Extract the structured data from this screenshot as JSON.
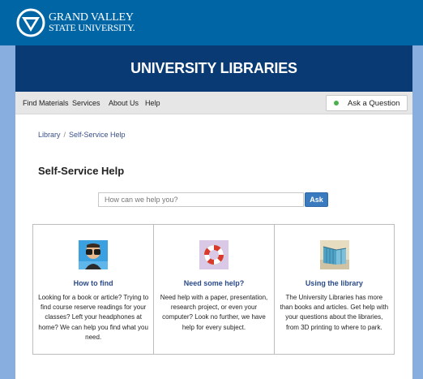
{
  "brand": {
    "logo_line1": "GRAND VALLEY",
    "logo_line2": "STATE UNIVERSITY."
  },
  "banner": {
    "title": "UNIVERSITY LIBRARIES"
  },
  "nav": {
    "items": [
      "Find Materials",
      "Services",
      "About Us",
      "Help"
    ],
    "ask_label": "Ask a Question",
    "ask_status_color": "#4caf50"
  },
  "breadcrumb": {
    "home": "Library",
    "separator": "/",
    "current": "Self-Service Help"
  },
  "page": {
    "title": "Self-Service Help"
  },
  "search": {
    "placeholder": "How can we help you?",
    "button_label": "Ask"
  },
  "panels": [
    {
      "icon": "binoculars-icon",
      "title": "How to find",
      "description": "Looking for a book or article? Trying to find course reserve readings for your classes? Left your headphones at home? We can help you find what you need."
    },
    {
      "icon": "life-preserver-icon",
      "title": "Need some help?",
      "description": "Need help with a paper, presentation, research project, or even your computer? Look no further, we have help for every subject."
    },
    {
      "icon": "library-building-icon",
      "title": "Using the library",
      "description": "The University Libraries has more than books and articles. Get help with your questions about the libraries, from 3D printing to where to park."
    }
  ],
  "colors": {
    "top_bar": "#0065a4",
    "banner": "#0a3a73",
    "page_bg": "#88aee0",
    "accent_button": "#3a7abf",
    "link": "#2a4a8a"
  }
}
